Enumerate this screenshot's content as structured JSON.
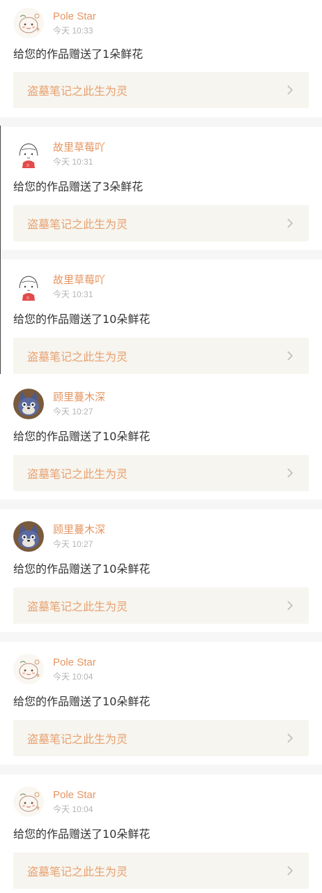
{
  "notifications": [
    {
      "user": "Pole Star",
      "time": "今天 10:33",
      "message": "给您的作品赠送了1朵鲜花",
      "work": "盗墓笔记之此生为灵",
      "avatar_icon": "doodle-avatar-icon"
    },
    {
      "user": "故里草莓吖",
      "time": "今天 10:31",
      "message": "给您的作品赠送了3朵鲜花",
      "work": "盗墓笔记之此生为灵",
      "avatar_icon": "girl-sketch-avatar-icon"
    },
    {
      "user": "故里草莓吖",
      "time": "今天 10:31",
      "message": "给您的作品赠送了10朵鲜花",
      "work": "盗墓笔记之此生为灵",
      "avatar_icon": "girl-sketch-avatar-icon"
    },
    {
      "user": "顾里蔓木深",
      "time": "今天 10:27",
      "message": "给您的作品赠送了10朵鲜花",
      "work": "盗墓笔记之此生为灵",
      "avatar_icon": "cartoon-cat-avatar-icon"
    },
    {
      "user": "顾里蔓木深",
      "time": "今天 10:27",
      "message": "给您的作品赠送了10朵鲜花",
      "work": "盗墓笔记之此生为灵",
      "avatar_icon": "cartoon-cat-avatar-icon"
    },
    {
      "user": "Pole Star",
      "time": "今天 10:04",
      "message": "给您的作品赠送了10朵鲜花",
      "work": "盗墓笔记之此生为灵",
      "avatar_icon": "doodle-avatar-icon"
    },
    {
      "user": "Pole Star",
      "time": "今天 10:04",
      "message": "给您的作品赠送了10朵鲜花",
      "work": "盗墓笔记之此生为灵",
      "avatar_icon": "doodle-avatar-icon"
    }
  ],
  "colors": {
    "name": "#e59561",
    "work_title": "#e8a06f",
    "time": "#b3b3b3",
    "work_bg": "#f6f5ef",
    "separator": "#f6f6f6"
  }
}
